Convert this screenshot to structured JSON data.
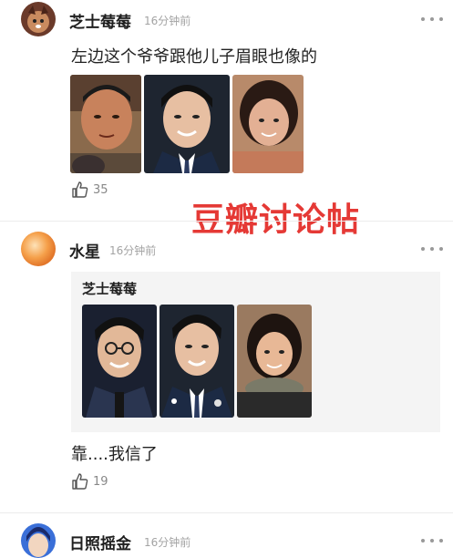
{
  "comments": [
    {
      "username": "芝士莓莓",
      "timestamp": "16分钟前",
      "text": "左边这个爷爷跟他儿子眉眼也像的",
      "likes": "35",
      "avatar_color": "#6b3a2a"
    },
    {
      "username": "水星",
      "timestamp": "16分钟前",
      "quote_author": "芝士莓莓",
      "text": "靠....我信了",
      "likes": "19",
      "avatar_color": "#f5a04a"
    },
    {
      "username": "日照摇金",
      "timestamp": "16分钟前",
      "avatar_color": "#3a6fd8"
    }
  ],
  "watermark": "豆瓣讨论帖",
  "icons": {
    "more": "more-dots-icon",
    "like": "thumbs-up-icon"
  },
  "colors": {
    "watermark": "#e53935",
    "timestamp": "#a3a3a3"
  }
}
